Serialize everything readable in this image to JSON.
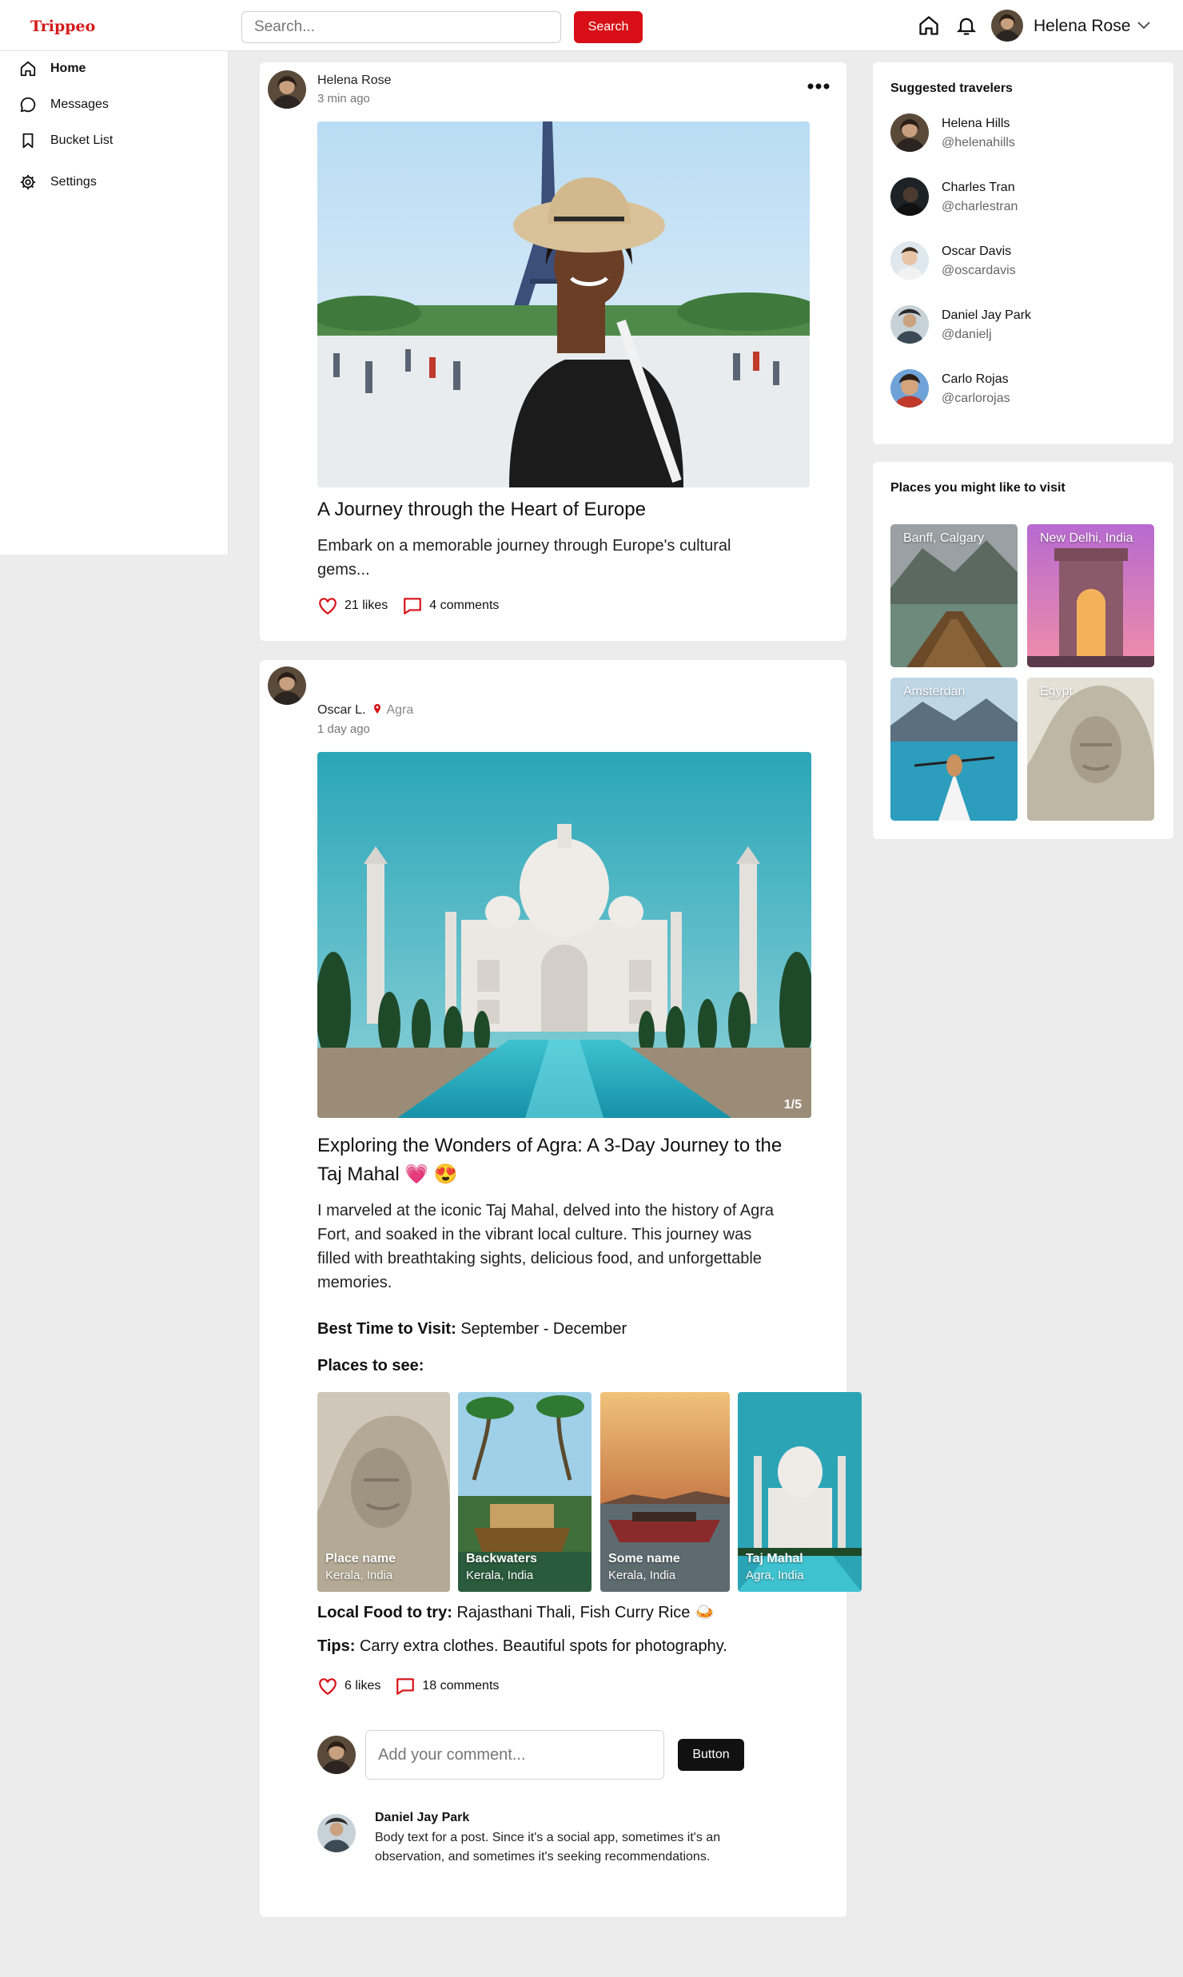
{
  "app": {
    "logo": "Trippeo"
  },
  "header": {
    "search_placeholder": "Search...",
    "search_button": "Search",
    "user_name": "Helena Rose"
  },
  "sidebar": {
    "items": [
      {
        "label": "Home",
        "icon": "home-icon"
      },
      {
        "label": "Messages",
        "icon": "message-icon"
      },
      {
        "label": "Bucket List",
        "icon": "bookmark-icon"
      },
      {
        "label": "Settings",
        "icon": "gear-icon"
      }
    ]
  },
  "posts": [
    {
      "author": "Helena Rose",
      "time": "3 min ago",
      "title": "A Journey through the Heart of Europe",
      "body": "Embark on a memorable journey through Europe's cultural gems...",
      "likes": "21 likes",
      "comments": "4 comments"
    },
    {
      "author": "Oscar L.",
      "location": "Agra",
      "time": "1 day ago",
      "image_counter": "1/5",
      "title": "Exploring the Wonders of Agra: A 3-Day Journey to the Taj Mahal 💗 😍",
      "body": "I marveled at the iconic Taj Mahal, delved into the history of Agra Fort, and soaked in the vibrant local culture. This journey was filled with breathtaking sights, delicious food, and unforgettable memories.",
      "best_time_label": "Best Time to Visit:",
      "best_time_value": "September - December",
      "places_label": "Places to see:",
      "places": [
        {
          "name": "Place name",
          "location": "Kerala, India"
        },
        {
          "name": "Backwaters",
          "location": "Kerala, India"
        },
        {
          "name": "Some name",
          "location": "Kerala, India"
        },
        {
          "name": "Taj Mahal",
          "location": "Agra, India"
        }
      ],
      "food_label": "Local Food to try:",
      "food_value": "Rajasthani Thali, Fish Curry Rice 🍛",
      "tips_label": "Tips:",
      "tips_value": "Carry extra clothes. Beautiful spots for photography.",
      "likes": "6 likes",
      "comments": "18 comments",
      "comment_placeholder": "Add your comment...",
      "comment_button": "Button",
      "comment": {
        "author": "Daniel Jay Park",
        "text": "Body text for a post. Since it's a social app, sometimes it's an observation, and sometimes it's seeking recommendations."
      }
    }
  ],
  "suggested": {
    "title": "Suggested travelers",
    "travelers": [
      {
        "name": "Helena Hills",
        "handle": "@helenahills"
      },
      {
        "name": "Charles Tran",
        "handle": "@charlestran"
      },
      {
        "name": "Oscar Davis",
        "handle": "@oscardavis"
      },
      {
        "name": "Daniel Jay Park",
        "handle": "@danielj"
      },
      {
        "name": "Carlo Rojas",
        "handle": "@carlorojas"
      }
    ]
  },
  "places_to_visit": {
    "title": "Places you might like to visit",
    "places": [
      "Banff, Calgary",
      "New Delhi, India",
      "Amsterdan",
      "Egypt"
    ]
  },
  "colors": {
    "brand": "#d80f16",
    "page_bg": "#ececec",
    "dark_button": "#111111"
  }
}
